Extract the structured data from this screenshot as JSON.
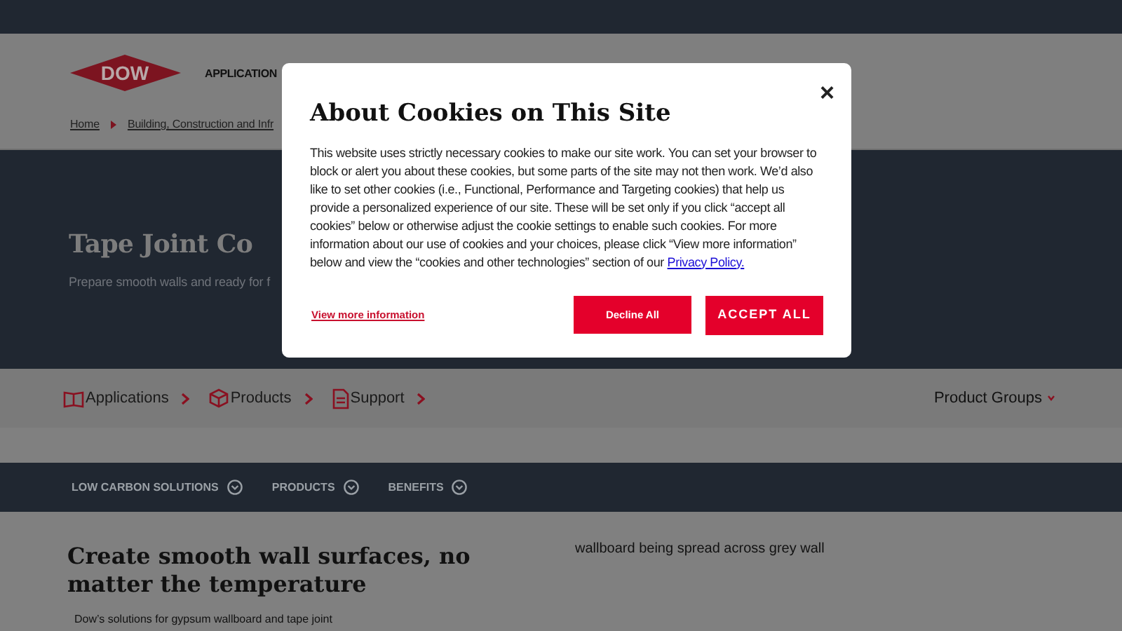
{
  "header": {
    "logo": "DOW",
    "nav_item": "APPLICATION"
  },
  "breadcrumb": [
    "Home",
    "Building, Construction and Infr"
  ],
  "hero": {
    "title": "Tape Joint Co",
    "subtitle": "Prepare smooth walls and ready for f"
  },
  "category_nav": [
    {
      "label": "Applications",
      "kind": "book"
    },
    {
      "label": "Products",
      "kind": "box"
    },
    {
      "label": "Support",
      "kind": "document"
    }
  ],
  "product_groups": "Product Groups",
  "section_tabs": [
    "LOW CARBON SOLUTIONS",
    "PRODUCTS",
    "BENEFITS"
  ],
  "content": {
    "heading": "Create smooth wall surfaces, no matter the temperature",
    "body": "Dow’s solutions for gypsum wallboard and tape joint",
    "image_alt": "wallboard being spread across grey wall"
  },
  "cookie_dialog": {
    "title": "About Cookies on This Site",
    "close": "×",
    "body": "This website uses strictly necessary cookies to make our site work. You can set your browser to block or alert you about these cookies, but some parts of the site may not then work. We’d also like to set other cookies (i.e., Functional, Performance and Targeting cookies) that help us provide a personalized experience of our site. These will be set only if you click “accept all cookies” below or otherwise adjust the cookie settings to enable such cookies. For more information about our use of cookies and your choices, please click “View more information” below and view the “cookies and other technologies” section of our",
    "privacy_link": "Privacy Policy.",
    "more_info": "View more information",
    "decline": "Decline All",
    "accept": "ACCEPT ALL"
  }
}
